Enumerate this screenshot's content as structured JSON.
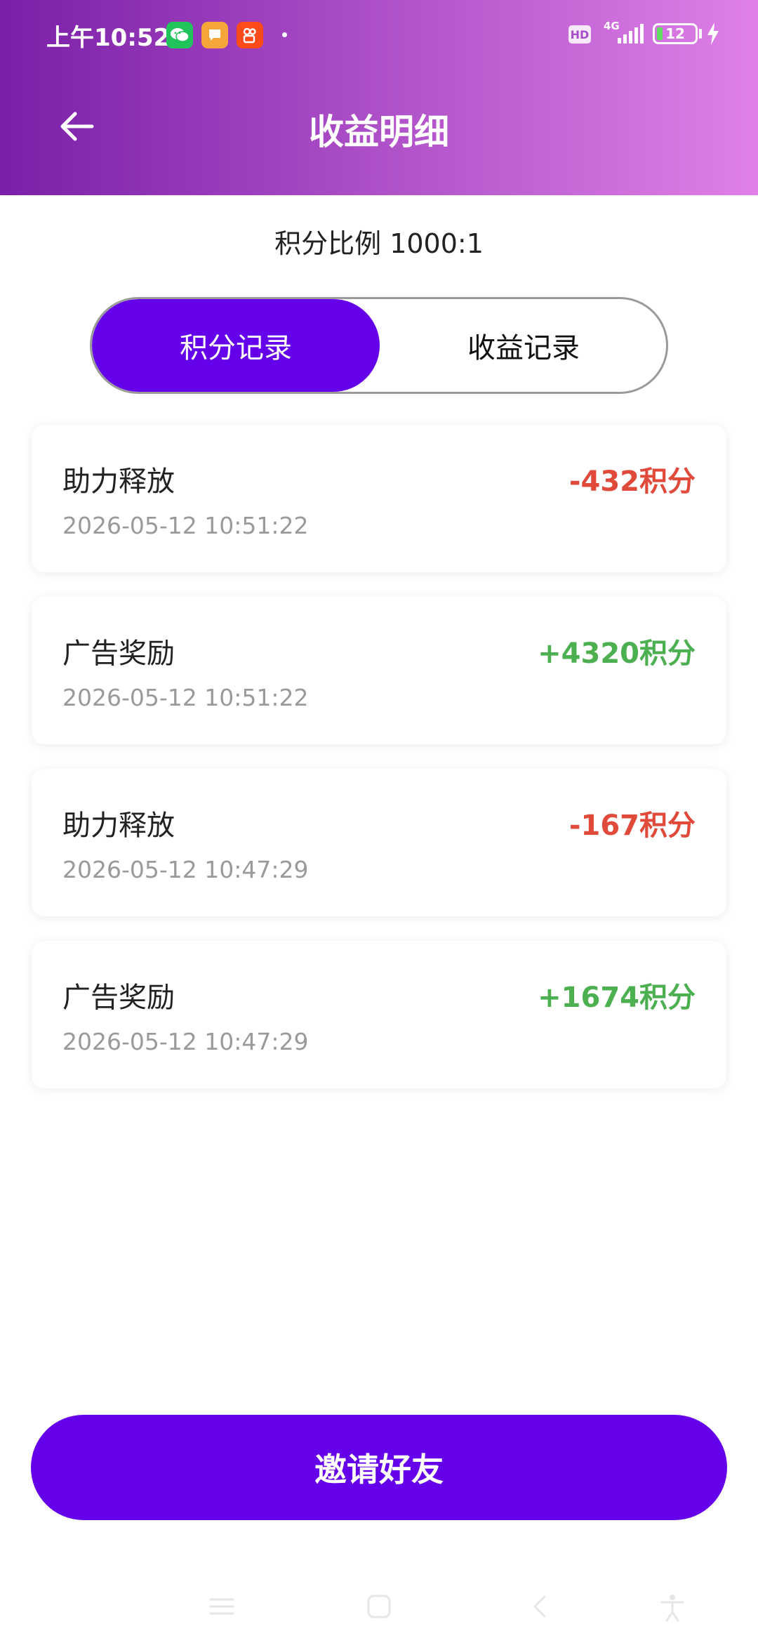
{
  "statusbar": {
    "time": "上午10:52",
    "apps": [
      "wechat-icon",
      "message-icon",
      "kuaishou-icon"
    ],
    "hd": "HD",
    "network": "4G",
    "battery": "12"
  },
  "header": {
    "title": "收益明细",
    "back_icon": "arrow-left-icon"
  },
  "ratio_text": "积分比例 1000:1",
  "tabs": [
    {
      "label": "积分记录",
      "active": true
    },
    {
      "label": "收益记录",
      "active": false
    }
  ],
  "records": [
    {
      "title": "助力释放",
      "time": "2026-05-12 10:51:22",
      "amount": "-432积分",
      "type": "negative"
    },
    {
      "title": "广告奖励",
      "time": "2026-05-12 10:51:22",
      "amount": "+4320积分",
      "type": "positive"
    },
    {
      "title": "助力释放",
      "time": "2026-05-12 10:47:29",
      "amount": "-167积分",
      "type": "negative"
    },
    {
      "title": "广告奖励",
      "time": "2026-05-12 10:47:29",
      "amount": "+1674积分",
      "type": "positive"
    }
  ],
  "colors": {
    "accent": "#6500ea",
    "negative": "#e04a3a",
    "positive": "#4caf50",
    "header_start": "#7a1fa8",
    "header_end": "#e080e8"
  },
  "invite_button": "邀请好友",
  "system_nav": [
    "menu-icon",
    "home-icon",
    "back-icon",
    "accessibility-icon"
  ]
}
